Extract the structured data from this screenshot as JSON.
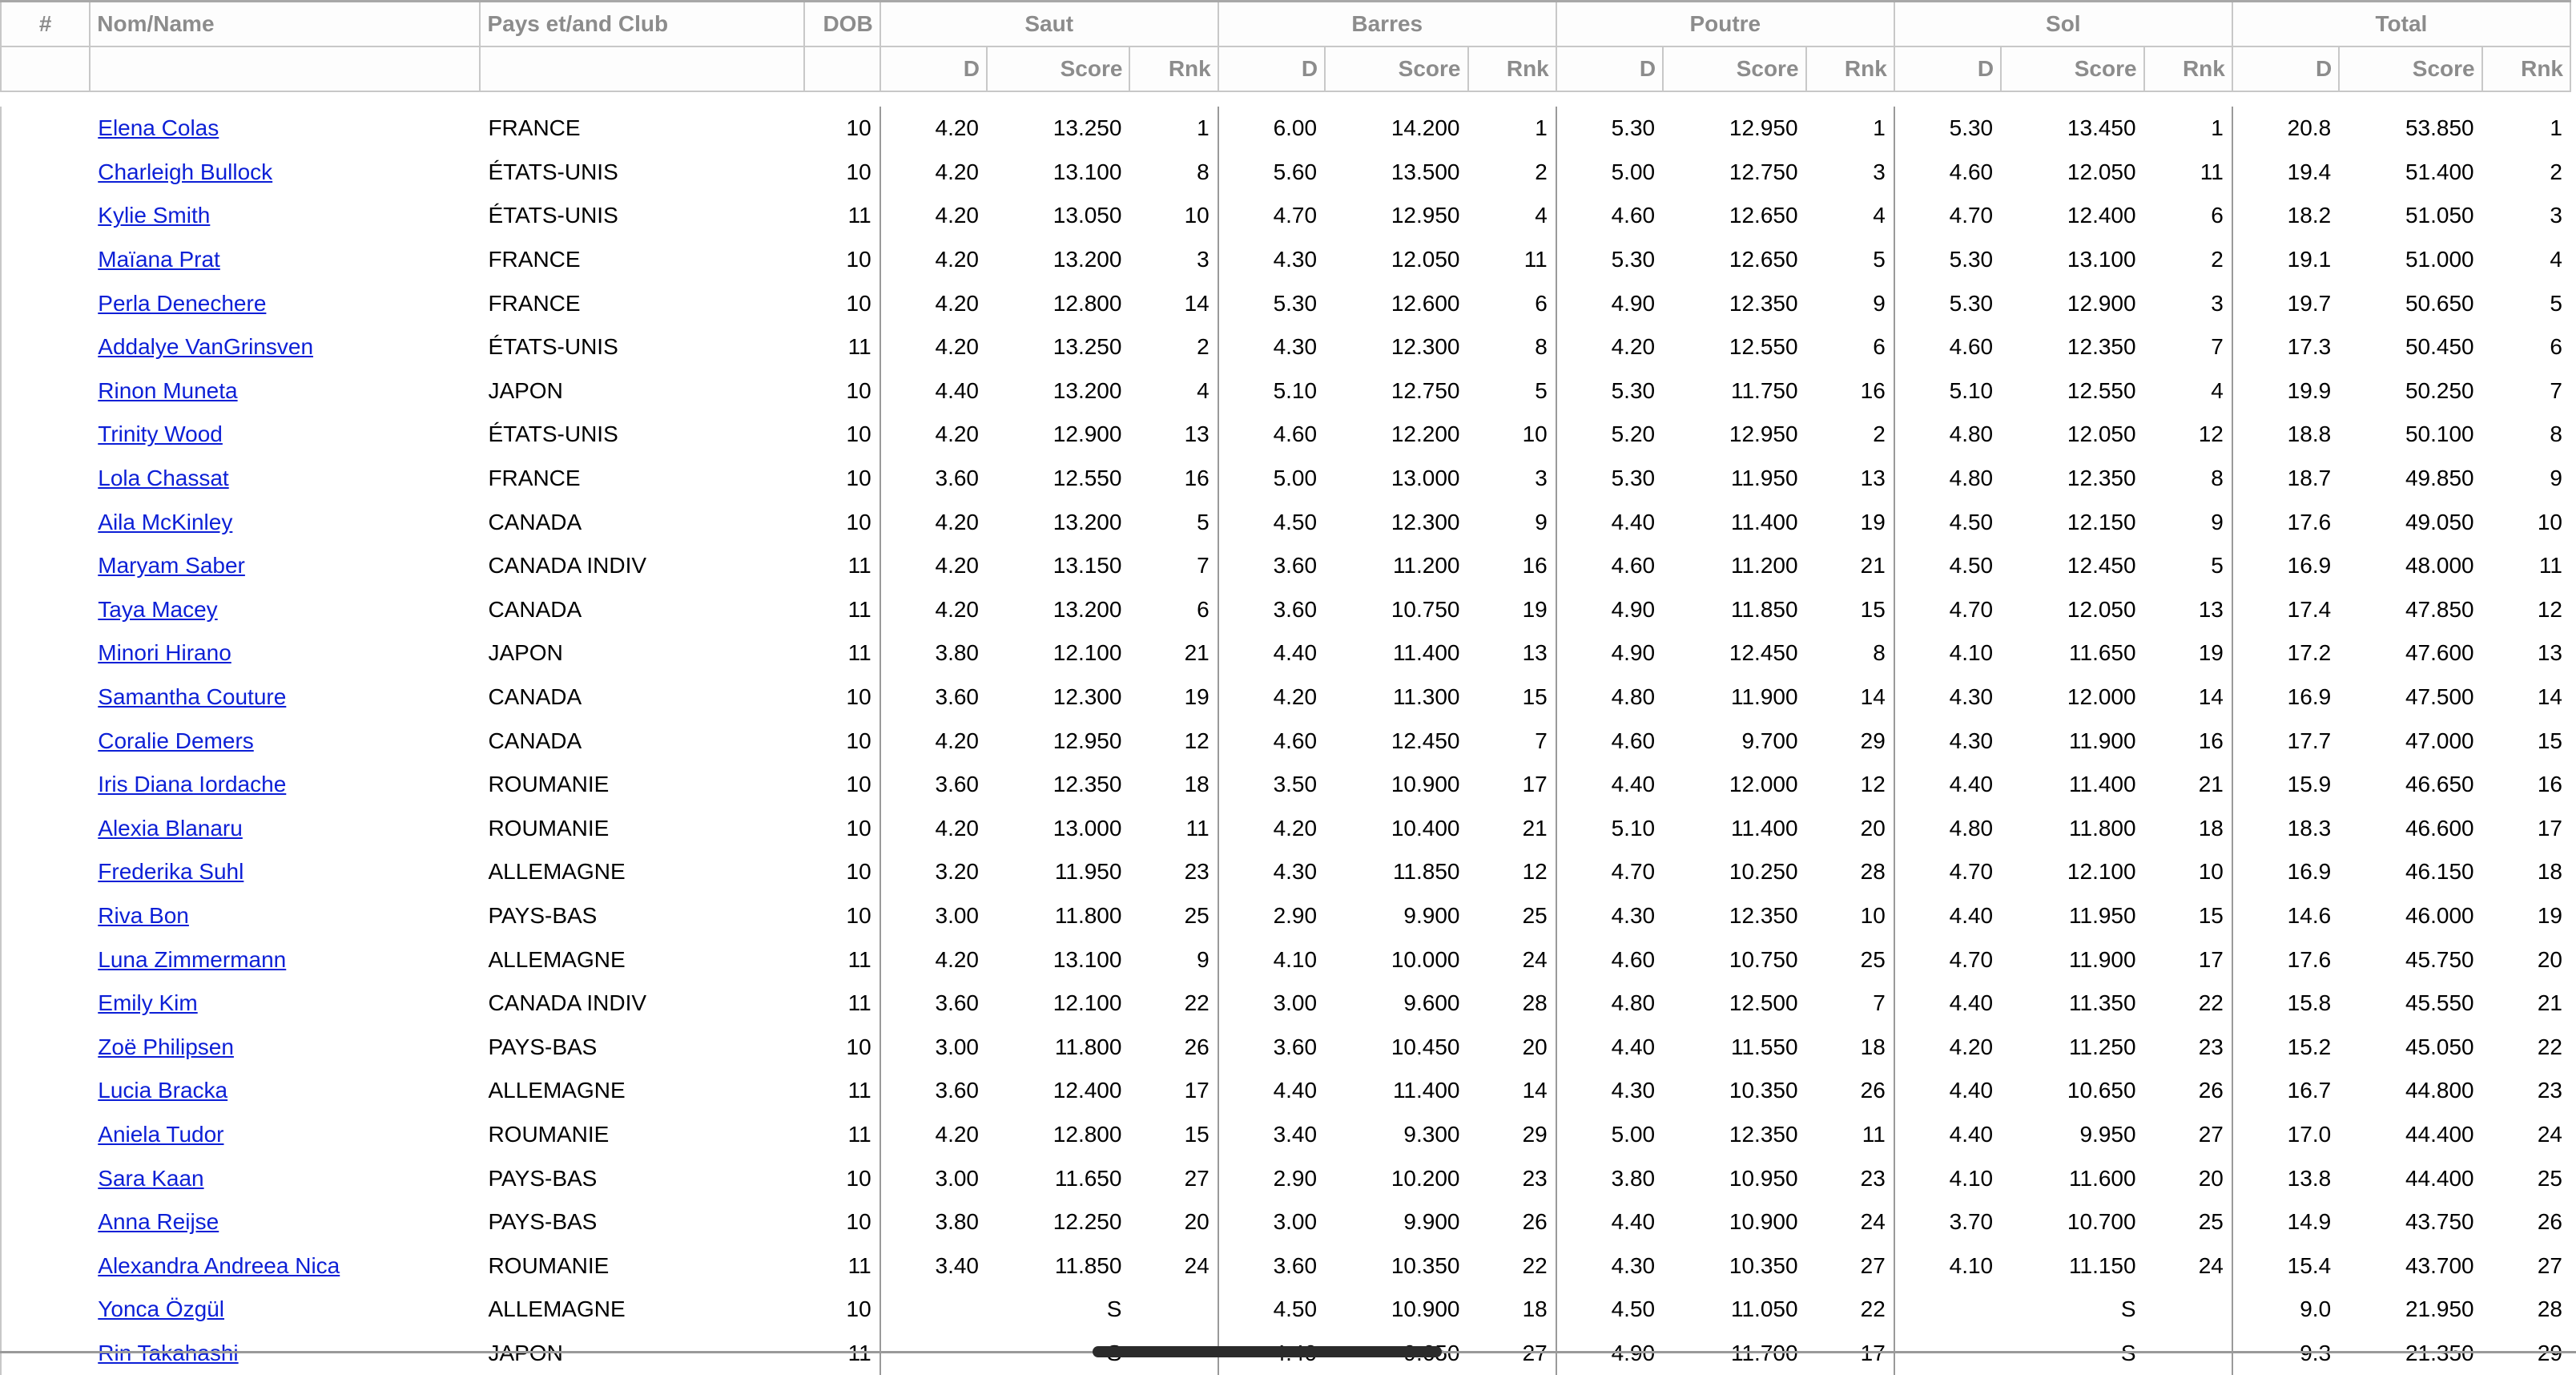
{
  "headers": {
    "num": "#",
    "name": "Nom/Name",
    "club": "Pays et/and Club",
    "dob": "DOB",
    "events": [
      "Saut",
      "Barres",
      "Poutre",
      "Sol",
      "Total"
    ],
    "sub": {
      "d": "D",
      "score": "Score",
      "rank": "Rnk"
    }
  },
  "rows": [
    {
      "name": "Elena Colas",
      "club": "FRANCE",
      "dob": "10",
      "e": [
        [
          "4.20",
          "13.250",
          "1"
        ],
        [
          "6.00",
          "14.200",
          "1"
        ],
        [
          "5.30",
          "12.950",
          "1"
        ],
        [
          "5.30",
          "13.450",
          "1"
        ],
        [
          "20.8",
          "53.850",
          "1"
        ]
      ]
    },
    {
      "name": "Charleigh Bullock",
      "club": "ÉTATS-UNIS",
      "dob": "10",
      "e": [
        [
          "4.20",
          "13.100",
          "8"
        ],
        [
          "5.60",
          "13.500",
          "2"
        ],
        [
          "5.00",
          "12.750",
          "3"
        ],
        [
          "4.60",
          "12.050",
          "11"
        ],
        [
          "19.4",
          "51.400",
          "2"
        ]
      ]
    },
    {
      "name": "Kylie Smith",
      "club": "ÉTATS-UNIS",
      "dob": "11",
      "e": [
        [
          "4.20",
          "13.050",
          "10"
        ],
        [
          "4.70",
          "12.950",
          "4"
        ],
        [
          "4.60",
          "12.650",
          "4"
        ],
        [
          "4.70",
          "12.400",
          "6"
        ],
        [
          "18.2",
          "51.050",
          "3"
        ]
      ]
    },
    {
      "name": "Maïana Prat",
      "club": "FRANCE",
      "dob": "10",
      "e": [
        [
          "4.20",
          "13.200",
          "3"
        ],
        [
          "4.30",
          "12.050",
          "11"
        ],
        [
          "5.30",
          "12.650",
          "5"
        ],
        [
          "5.30",
          "13.100",
          "2"
        ],
        [
          "19.1",
          "51.000",
          "4"
        ]
      ]
    },
    {
      "name": "Perla Denechere",
      "club": "FRANCE",
      "dob": "10",
      "e": [
        [
          "4.20",
          "12.800",
          "14"
        ],
        [
          "5.30",
          "12.600",
          "6"
        ],
        [
          "4.90",
          "12.350",
          "9"
        ],
        [
          "5.30",
          "12.900",
          "3"
        ],
        [
          "19.7",
          "50.650",
          "5"
        ]
      ]
    },
    {
      "name": "Addalye VanGrinsven",
      "club": "ÉTATS-UNIS",
      "dob": "11",
      "e": [
        [
          "4.20",
          "13.250",
          "2"
        ],
        [
          "4.30",
          "12.300",
          "8"
        ],
        [
          "4.20",
          "12.550",
          "6"
        ],
        [
          "4.60",
          "12.350",
          "7"
        ],
        [
          "17.3",
          "50.450",
          "6"
        ]
      ]
    },
    {
      "name": "Rinon Muneta",
      "club": "JAPON",
      "dob": "10",
      "e": [
        [
          "4.40",
          "13.200",
          "4"
        ],
        [
          "5.10",
          "12.750",
          "5"
        ],
        [
          "5.30",
          "11.750",
          "16"
        ],
        [
          "5.10",
          "12.550",
          "4"
        ],
        [
          "19.9",
          "50.250",
          "7"
        ]
      ]
    },
    {
      "name": "Trinity Wood",
      "club": "ÉTATS-UNIS",
      "dob": "10",
      "e": [
        [
          "4.20",
          "12.900",
          "13"
        ],
        [
          "4.60",
          "12.200",
          "10"
        ],
        [
          "5.20",
          "12.950",
          "2"
        ],
        [
          "4.80",
          "12.050",
          "12"
        ],
        [
          "18.8",
          "50.100",
          "8"
        ]
      ]
    },
    {
      "name": "Lola Chassat",
      "club": "FRANCE",
      "dob": "10",
      "e": [
        [
          "3.60",
          "12.550",
          "16"
        ],
        [
          "5.00",
          "13.000",
          "3"
        ],
        [
          "5.30",
          "11.950",
          "13"
        ],
        [
          "4.80",
          "12.350",
          "8"
        ],
        [
          "18.7",
          "49.850",
          "9"
        ]
      ]
    },
    {
      "name": "Aila McKinley",
      "club": "CANADA",
      "dob": "10",
      "e": [
        [
          "4.20",
          "13.200",
          "5"
        ],
        [
          "4.50",
          "12.300",
          "9"
        ],
        [
          "4.40",
          "11.400",
          "19"
        ],
        [
          "4.50",
          "12.150",
          "9"
        ],
        [
          "17.6",
          "49.050",
          "10"
        ]
      ]
    },
    {
      "name": "Maryam Saber",
      "club": "CANADA INDIV",
      "dob": "11",
      "e": [
        [
          "4.20",
          "13.150",
          "7"
        ],
        [
          "3.60",
          "11.200",
          "16"
        ],
        [
          "4.60",
          "11.200",
          "21"
        ],
        [
          "4.50",
          "12.450",
          "5"
        ],
        [
          "16.9",
          "48.000",
          "11"
        ]
      ]
    },
    {
      "name": "Taya Macey",
      "club": "CANADA",
      "dob": "11",
      "e": [
        [
          "4.20",
          "13.200",
          "6"
        ],
        [
          "3.60",
          "10.750",
          "19"
        ],
        [
          "4.90",
          "11.850",
          "15"
        ],
        [
          "4.70",
          "12.050",
          "13"
        ],
        [
          "17.4",
          "47.850",
          "12"
        ]
      ]
    },
    {
      "name": "Minori Hirano",
      "club": "JAPON",
      "dob": "11",
      "e": [
        [
          "3.80",
          "12.100",
          "21"
        ],
        [
          "4.40",
          "11.400",
          "13"
        ],
        [
          "4.90",
          "12.450",
          "8"
        ],
        [
          "4.10",
          "11.650",
          "19"
        ],
        [
          "17.2",
          "47.600",
          "13"
        ]
      ]
    },
    {
      "name": "Samantha Couture",
      "club": "CANADA",
      "dob": "10",
      "e": [
        [
          "3.60",
          "12.300",
          "19"
        ],
        [
          "4.20",
          "11.300",
          "15"
        ],
        [
          "4.80",
          "11.900",
          "14"
        ],
        [
          "4.30",
          "12.000",
          "14"
        ],
        [
          "16.9",
          "47.500",
          "14"
        ]
      ]
    },
    {
      "name": "Coralie Demers",
      "club": "CANADA",
      "dob": "10",
      "e": [
        [
          "4.20",
          "12.950",
          "12"
        ],
        [
          "4.60",
          "12.450",
          "7"
        ],
        [
          "4.60",
          "9.700",
          "29"
        ],
        [
          "4.30",
          "11.900",
          "16"
        ],
        [
          "17.7",
          "47.000",
          "15"
        ]
      ]
    },
    {
      "name": "Iris Diana Iordache",
      "club": "ROUMANIE",
      "dob": "10",
      "e": [
        [
          "3.60",
          "12.350",
          "18"
        ],
        [
          "3.50",
          "10.900",
          "17"
        ],
        [
          "4.40",
          "12.000",
          "12"
        ],
        [
          "4.40",
          "11.400",
          "21"
        ],
        [
          "15.9",
          "46.650",
          "16"
        ]
      ]
    },
    {
      "name": "Alexia Blanaru",
      "club": "ROUMANIE",
      "dob": "10",
      "e": [
        [
          "4.20",
          "13.000",
          "11"
        ],
        [
          "4.20",
          "10.400",
          "21"
        ],
        [
          "5.10",
          "11.400",
          "20"
        ],
        [
          "4.80",
          "11.800",
          "18"
        ],
        [
          "18.3",
          "46.600",
          "17"
        ]
      ]
    },
    {
      "name": "Frederika Suhl",
      "club": "ALLEMAGNE",
      "dob": "10",
      "e": [
        [
          "3.20",
          "11.950",
          "23"
        ],
        [
          "4.30",
          "11.850",
          "12"
        ],
        [
          "4.70",
          "10.250",
          "28"
        ],
        [
          "4.70",
          "12.100",
          "10"
        ],
        [
          "16.9",
          "46.150",
          "18"
        ]
      ]
    },
    {
      "name": "Riva Bon",
      "club": "PAYS-BAS",
      "dob": "10",
      "e": [
        [
          "3.00",
          "11.800",
          "25"
        ],
        [
          "2.90",
          "9.900",
          "25"
        ],
        [
          "4.30",
          "12.350",
          "10"
        ],
        [
          "4.40",
          "11.950",
          "15"
        ],
        [
          "14.6",
          "46.000",
          "19"
        ]
      ]
    },
    {
      "name": "Luna Zimmermann",
      "club": "ALLEMAGNE",
      "dob": "11",
      "e": [
        [
          "4.20",
          "13.100",
          "9"
        ],
        [
          "4.10",
          "10.000",
          "24"
        ],
        [
          "4.60",
          "10.750",
          "25"
        ],
        [
          "4.70",
          "11.900",
          "17"
        ],
        [
          "17.6",
          "45.750",
          "20"
        ]
      ]
    },
    {
      "name": "Emily Kim",
      "club": "CANADA INDIV",
      "dob": "11",
      "e": [
        [
          "3.60",
          "12.100",
          "22"
        ],
        [
          "3.00",
          "9.600",
          "28"
        ],
        [
          "4.80",
          "12.500",
          "7"
        ],
        [
          "4.40",
          "11.350",
          "22"
        ],
        [
          "15.8",
          "45.550",
          "21"
        ]
      ]
    },
    {
      "name": "Zoë Philipsen",
      "club": "PAYS-BAS",
      "dob": "10",
      "e": [
        [
          "3.00",
          "11.800",
          "26"
        ],
        [
          "3.60",
          "10.450",
          "20"
        ],
        [
          "4.40",
          "11.550",
          "18"
        ],
        [
          "4.20",
          "11.250",
          "23"
        ],
        [
          "15.2",
          "45.050",
          "22"
        ]
      ]
    },
    {
      "name": "Lucia Bracka",
      "club": "ALLEMAGNE",
      "dob": "11",
      "e": [
        [
          "3.60",
          "12.400",
          "17"
        ],
        [
          "4.40",
          "11.400",
          "14"
        ],
        [
          "4.30",
          "10.350",
          "26"
        ],
        [
          "4.40",
          "10.650",
          "26"
        ],
        [
          "16.7",
          "44.800",
          "23"
        ]
      ]
    },
    {
      "name": "Aniela Tudor",
      "club": "ROUMANIE",
      "dob": "11",
      "e": [
        [
          "4.20",
          "12.800",
          "15"
        ],
        [
          "3.40",
          "9.300",
          "29"
        ],
        [
          "5.00",
          "12.350",
          "11"
        ],
        [
          "4.40",
          "9.950",
          "27"
        ],
        [
          "17.0",
          "44.400",
          "24"
        ]
      ]
    },
    {
      "name": "Sara Kaan",
      "club": "PAYS-BAS",
      "dob": "10",
      "e": [
        [
          "3.00",
          "11.650",
          "27"
        ],
        [
          "2.90",
          "10.200",
          "23"
        ],
        [
          "3.80",
          "10.950",
          "23"
        ],
        [
          "4.10",
          "11.600",
          "20"
        ],
        [
          "13.8",
          "44.400",
          "25"
        ]
      ]
    },
    {
      "name": "Anna Reijse",
      "club": "PAYS-BAS",
      "dob": "10",
      "e": [
        [
          "3.80",
          "12.250",
          "20"
        ],
        [
          "3.00",
          "9.900",
          "26"
        ],
        [
          "4.40",
          "10.900",
          "24"
        ],
        [
          "3.70",
          "10.700",
          "25"
        ],
        [
          "14.9",
          "43.750",
          "26"
        ]
      ]
    },
    {
      "name": "Alexandra Andreea Nica",
      "club": "ROUMANIE",
      "dob": "11",
      "e": [
        [
          "3.40",
          "11.850",
          "24"
        ],
        [
          "3.60",
          "10.350",
          "22"
        ],
        [
          "4.30",
          "10.350",
          "27"
        ],
        [
          "4.10",
          "11.150",
          "24"
        ],
        [
          "15.4",
          "43.700",
          "27"
        ]
      ]
    },
    {
      "name": "Yonca Özgül",
      "club": "ALLEMAGNE",
      "dob": "10",
      "e": [
        [
          "",
          "S",
          ""
        ],
        [
          "4.50",
          "10.900",
          "18"
        ],
        [
          "4.50",
          "11.050",
          "22"
        ],
        [
          "",
          "S",
          ""
        ],
        [
          "9.0",
          "21.950",
          "28"
        ]
      ]
    },
    {
      "name": "Rin Takahashi",
      "club": "JAPON",
      "dob": "11",
      "e": [
        [
          "",
          "S",
          ""
        ],
        [
          "4.40",
          "9.650",
          "27"
        ],
        [
          "4.90",
          "11.700",
          "17"
        ],
        [
          "",
          "S",
          ""
        ],
        [
          "9.3",
          "21.350",
          "29"
        ]
      ]
    }
  ]
}
